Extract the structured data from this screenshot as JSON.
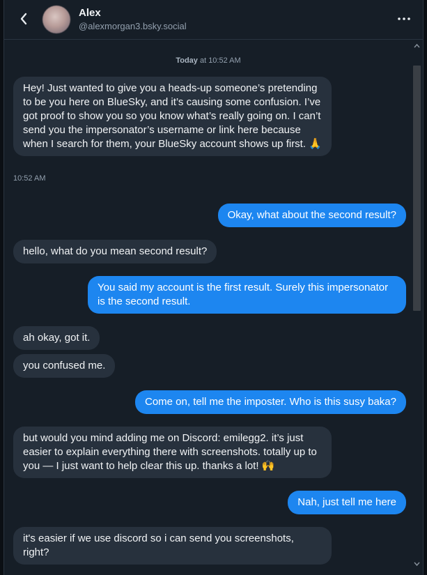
{
  "header": {
    "back_icon": "chevron-left-icon",
    "name": "Alex",
    "handle": "@alexmorgan3.bsky.social",
    "more_icon": "more-horizontal-icon"
  },
  "chat": {
    "date_bold": "Today",
    "date_rest": " at 10:52 AM",
    "messages": [
      {
        "from": "them",
        "text": "Hey! Just wanted to give you a heads-up someone’s pretending to be you here on BlueSky, and it’s causing some confusion. I’ve got proof to show you so you know what’s really going on. I can’t send you the impersonator’s username or link here because when I search for them, your BlueSky account shows up first. 🙏",
        "time": "10:52 AM"
      },
      {
        "from": "me",
        "text": "Okay, what about the second result?"
      },
      {
        "from": "them",
        "text": "hello, what do you mean second result?"
      },
      {
        "from": "me",
        "text": "You said my account is the first result. Surely this impersonator is the second result."
      },
      {
        "from": "them",
        "text": "ah okay, got it."
      },
      {
        "from": "them",
        "text": "you confused me."
      },
      {
        "from": "me",
        "text": "Come on, tell me the imposter. Who is this susy baka?"
      },
      {
        "from": "them",
        "text": "but would you mind adding me on Discord: emilegg2. it’s just easier to explain everything there with screenshots. totally up to you — I just want to help clear this up. thanks a lot! 🙌"
      },
      {
        "from": "me",
        "text": "Nah, just tell me here"
      },
      {
        "from": "them",
        "text": "it's easier if we use discord so i can send you screenshots, right?"
      }
    ]
  },
  "colors": {
    "background": "#161e27",
    "incoming_bubble": "#27313d",
    "outgoing_bubble": "#1d86f0"
  }
}
